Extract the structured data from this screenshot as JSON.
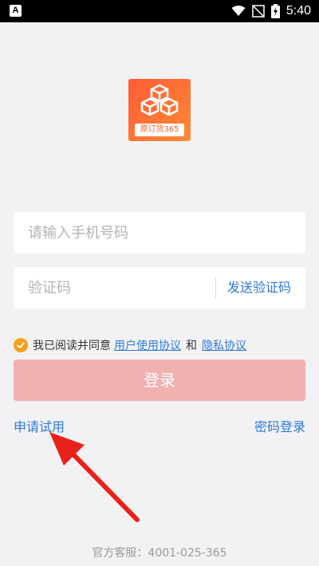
{
  "status_bar": {
    "app_icon_letter": "A",
    "time": "5:40"
  },
  "logo": {
    "label": "原订货365"
  },
  "phone": {
    "placeholder": "请输入手机号码"
  },
  "code": {
    "placeholder": "验证码",
    "send_label": "发送验证码"
  },
  "agreement": {
    "prefix": "我已阅读并同意",
    "user_agreement": "用户使用协议",
    "and": "和",
    "privacy": "隐私协议",
    "checked": true
  },
  "login": {
    "label": "登录"
  },
  "links": {
    "apply_trial": "申请试用",
    "password_login": "密码登录"
  },
  "footer": {
    "service": "官方客服：4001-025-365"
  },
  "colors": {
    "accent": "#2f7ad8",
    "check": "#f59f1b",
    "login_disabled": "#f0b1b0",
    "logo": "#ff6a35",
    "annotation": "#e8221b"
  }
}
